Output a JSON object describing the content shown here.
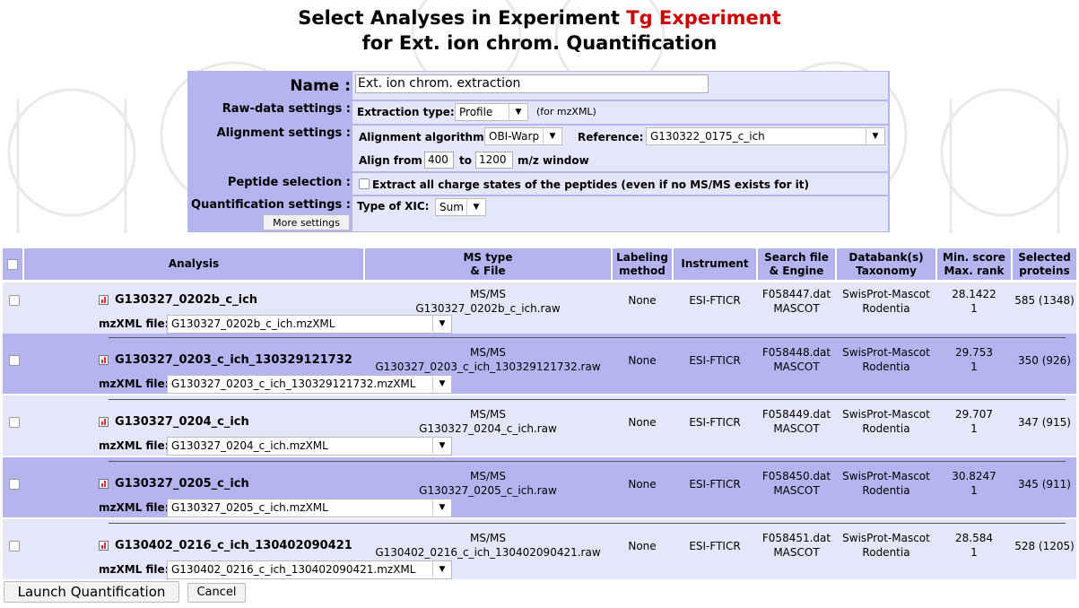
{
  "page": {
    "title_prefix": "Select Analyses in Experiment",
    "experiment_name": "Tg Experiment",
    "title_line2": "for Ext. ion chrom. Quantification"
  },
  "form": {
    "name_label": "Name :",
    "name_value": "Ext. ion chrom. extraction",
    "raw_label": "Raw-data settings :",
    "extraction_type_label": "Extraction type:",
    "extraction_type_value": "Profile",
    "extraction_note": "(for mzXML)",
    "alignment_label": "Alignment settings :",
    "alignment_algorithm_label": "Alignment algorithm:",
    "alignment_algorithm_value": "OBI-Warp",
    "reference_label": "Reference:",
    "reference_value": "G130322_0175_c_ich",
    "align_from_label": "Align from",
    "align_from_value": "400",
    "align_to_label": "to",
    "align_to_value": "1200",
    "mz_window_label": "m/z window",
    "peptide_label": "Peptide selection :",
    "peptide_option": "Extract all charge states of the peptides (even if no MS/MS exists for it)",
    "peptide_checked": false,
    "quant_label": "Quantification settings :",
    "more_settings": "More settings",
    "xic_type_label": "Type of XIC:",
    "xic_type_value": "Sum"
  },
  "table": {
    "headers": {
      "analysis": "Analysis",
      "ms_type_1": "MS type",
      "ms_type_2": "& File",
      "labeling_1": "Labeling",
      "labeling_2": "method",
      "instrument": "Instrument",
      "search_1": "Search file",
      "search_2": "& Engine",
      "databank_1": "Databank(s)",
      "databank_2": "Taxonomy",
      "min_score_1": "Min. score",
      "min_score_2": "Max. rank",
      "selected_1": "Selected",
      "selected_2": "proteins"
    },
    "mzxml_label": "mzXML file:",
    "rows": [
      {
        "name": "G130327_0202b_c_ich",
        "ms_type": "MS/MS",
        "raw_file": "G130327_0202b_c_ich.raw",
        "labeling": "None",
        "instrument": "ESI-FTICR",
        "search_file": "F058447.dat",
        "engine": "MASCOT",
        "databank": "SwisProt-Mascot",
        "taxonomy": "Rodentia",
        "min_score": "28.1422",
        "max_rank": "1",
        "selected": "585 (1348)",
        "mzxml_file": "G130327_0202b_c_ich.mzXML"
      },
      {
        "name": "G130327_0203_c_ich_130329121732",
        "ms_type": "MS/MS",
        "raw_file": "G130327_0203_c_ich_130329121732.raw",
        "labeling": "None",
        "instrument": "ESI-FTICR",
        "search_file": "F058448.dat",
        "engine": "MASCOT",
        "databank": "SwisProt-Mascot",
        "taxonomy": "Rodentia",
        "min_score": "29.753",
        "max_rank": "1",
        "selected": "350 (926)",
        "mzxml_file": "G130327_0203_c_ich_130329121732.mzXML"
      },
      {
        "name": "G130327_0204_c_ich",
        "ms_type": "MS/MS",
        "raw_file": "G130327_0204_c_ich.raw",
        "labeling": "None",
        "instrument": "ESI-FTICR",
        "search_file": "F058449.dat",
        "engine": "MASCOT",
        "databank": "SwisProt-Mascot",
        "taxonomy": "Rodentia",
        "min_score": "29.707",
        "max_rank": "1",
        "selected": "347 (915)",
        "mzxml_file": "G130327_0204_c_ich.mzXML"
      },
      {
        "name": "G130327_0205_c_ich",
        "ms_type": "MS/MS",
        "raw_file": "G130327_0205_c_ich.raw",
        "labeling": "None",
        "instrument": "ESI-FTICR",
        "search_file": "F058450.dat",
        "engine": "MASCOT",
        "databank": "SwisProt-Mascot",
        "taxonomy": "Rodentia",
        "min_score": "30.8247",
        "max_rank": "1",
        "selected": "345 (911)",
        "mzxml_file": "G130327_0205_c_ich.mzXML"
      },
      {
        "name": "G130402_0216_c_ich_130402090421",
        "ms_type": "MS/MS",
        "raw_file": "G130402_0216_c_ich_130402090421.raw",
        "labeling": "None",
        "instrument": "ESI-FTICR",
        "search_file": "F058451.dat",
        "engine": "MASCOT",
        "databank": "SwisProt-Mascot",
        "taxonomy": "Rodentia",
        "min_score": "28.584",
        "max_rank": "1",
        "selected": "528 (1205)",
        "mzxml_file": "G130402_0216_c_ich_130402090421.mzXML"
      }
    ]
  },
  "actions": {
    "launch": "Launch Quantification",
    "cancel": "Cancel"
  },
  "colors": {
    "header_bg": "#b4b4f0",
    "light_row": "#e6e6fa",
    "experiment_name": "#cc0000"
  }
}
